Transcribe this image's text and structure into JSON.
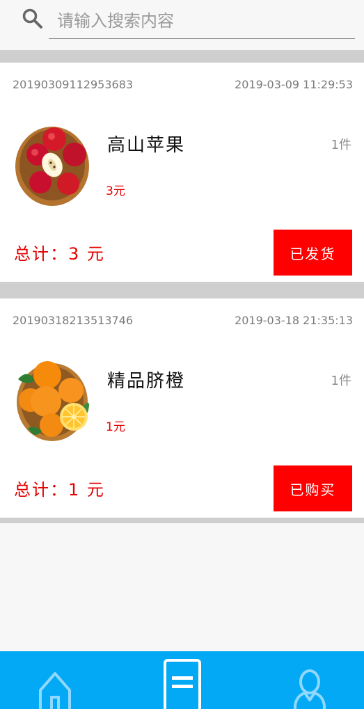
{
  "search": {
    "placeholder": "请输入搜索内容"
  },
  "orders": [
    {
      "order_no": "20190309112953683",
      "time": "2019-03-09  11:29:53",
      "product_name": "高山苹果",
      "quantity": "1件",
      "price": "3元",
      "total": "总计：3 元",
      "status": "已发货"
    },
    {
      "order_no": "20190318213513746",
      "time": "2019-03-18  21:35:13",
      "product_name": "精品脐橙",
      "quantity": "1件",
      "price": "1元",
      "total": "总计：1 元",
      "status": "已购买"
    }
  ],
  "nav": {
    "items": [
      {
        "icon": "home-icon",
        "active": false
      },
      {
        "icon": "orders-icon",
        "active": true
      },
      {
        "icon": "user-icon",
        "active": false
      }
    ]
  },
  "colors": {
    "accent": "#03a9f4",
    "price": "#e60000",
    "status_button": "#ff0000",
    "divider": "#cfcfcf"
  }
}
